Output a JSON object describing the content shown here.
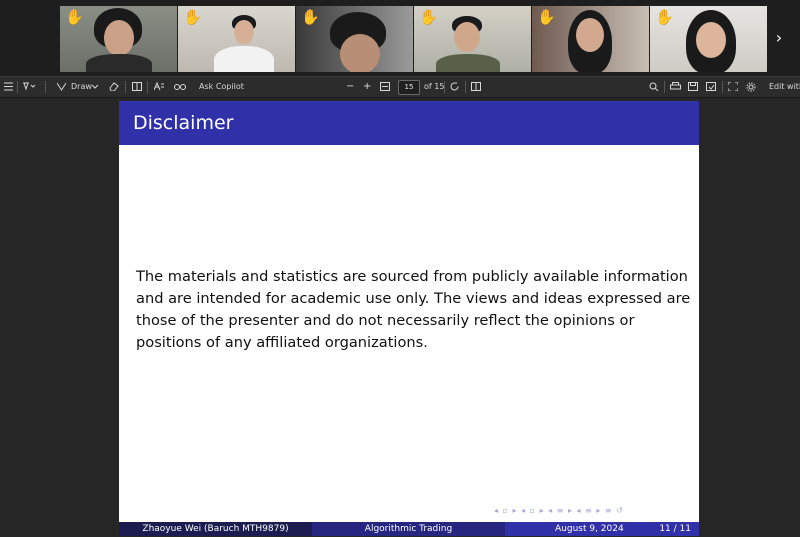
{
  "participants": [
    {
      "label": "participant-1",
      "raised_hand": true,
      "active": true
    },
    {
      "label": "participant-2",
      "raised_hand": true,
      "active": false
    },
    {
      "label": "participant-3",
      "raised_hand": true,
      "active": false
    },
    {
      "label": "participant-4",
      "raised_hand": true,
      "active": false
    },
    {
      "label": "participant-5",
      "raised_hand": true,
      "active": false
    },
    {
      "label": "participant-6",
      "raised_hand": true,
      "active": false
    }
  ],
  "toolbar": {
    "draw_label": "Draw",
    "ask_copilot_label": "Ask Copilot",
    "zoom_out": "−",
    "zoom_in": "+",
    "current_page": "15",
    "page_total": "of 15",
    "edit_label": "Edit with A",
    "hand_glyph": "✋",
    "next_glyph": "›"
  },
  "slide": {
    "title": "Disclaimer",
    "body": "The materials and statistics are sourced from publicly available information and are intended for academic use only. The views and ideas expressed are those of the presenter and do not necessarily reflect the opinions or positions of any affiliated organizations.",
    "nav_symbols": "◂ ▫ ▸ ◂ ▫ ▸ ◂ ≡ ▸ ◂ ≡ ▸ ≡ ↺",
    "footer": {
      "author": "Zhaoyue Wei (Baruch MTH9879)",
      "course": "Algorithmic Trading",
      "date": "August 9, 2024",
      "page": "11 / 11"
    }
  },
  "colors": {
    "slide_header": "#3030a8",
    "active_speaker": "#3fbf4f",
    "raised_hand": "#f6c343"
  }
}
